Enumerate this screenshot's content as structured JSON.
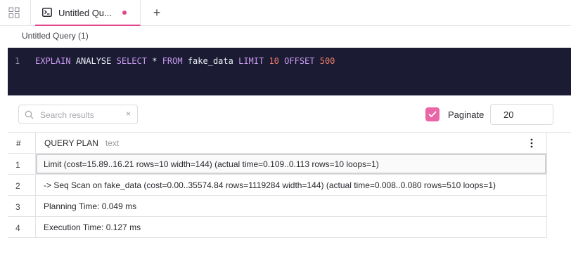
{
  "tabbar": {
    "grid_icon": "grid-icon",
    "tab": {
      "icon": "terminal-icon",
      "label": "Untitled Qu...",
      "unsaved_dot_color": "#e0478f"
    },
    "add_label": "+"
  },
  "query": {
    "title": "Untitled Query (1)"
  },
  "editor": {
    "line_number": "1",
    "tokens": {
      "explain": "EXPLAIN",
      "analyse": "ANALYSE",
      "select": "SELECT",
      "star": "*",
      "from": "FROM",
      "table": "fake_data",
      "limit": "LIMIT",
      "limit_val": "10",
      "offset": "OFFSET",
      "offset_val": "500"
    },
    "colors": {
      "background": "#1b1b33",
      "keyword": "#c99bf2",
      "number": "#f07d6b"
    }
  },
  "toolbar": {
    "search_placeholder": "Search results",
    "clear_label": "×",
    "paginate_label": "Paginate",
    "paginate_checked": true,
    "page_size": "20",
    "accent": "#ea65a5"
  },
  "results": {
    "headers": {
      "num": "#",
      "column": "QUERY PLAN",
      "column_type": "text"
    },
    "rows": [
      {
        "num": "1",
        "text": "Limit (cost=15.89..16.21 rows=10 width=144) (actual time=0.109..0.113 rows=10 loops=1)"
      },
      {
        "num": "2",
        "text": "-> Seq Scan on fake_data (cost=0.00..35574.84 rows=1119284 width=144) (actual time=0.008..0.080 rows=510 loops=1)"
      },
      {
        "num": "3",
        "text": "Planning Time: 0.049 ms"
      },
      {
        "num": "4",
        "text": "Execution Time: 0.127 ms"
      }
    ]
  }
}
